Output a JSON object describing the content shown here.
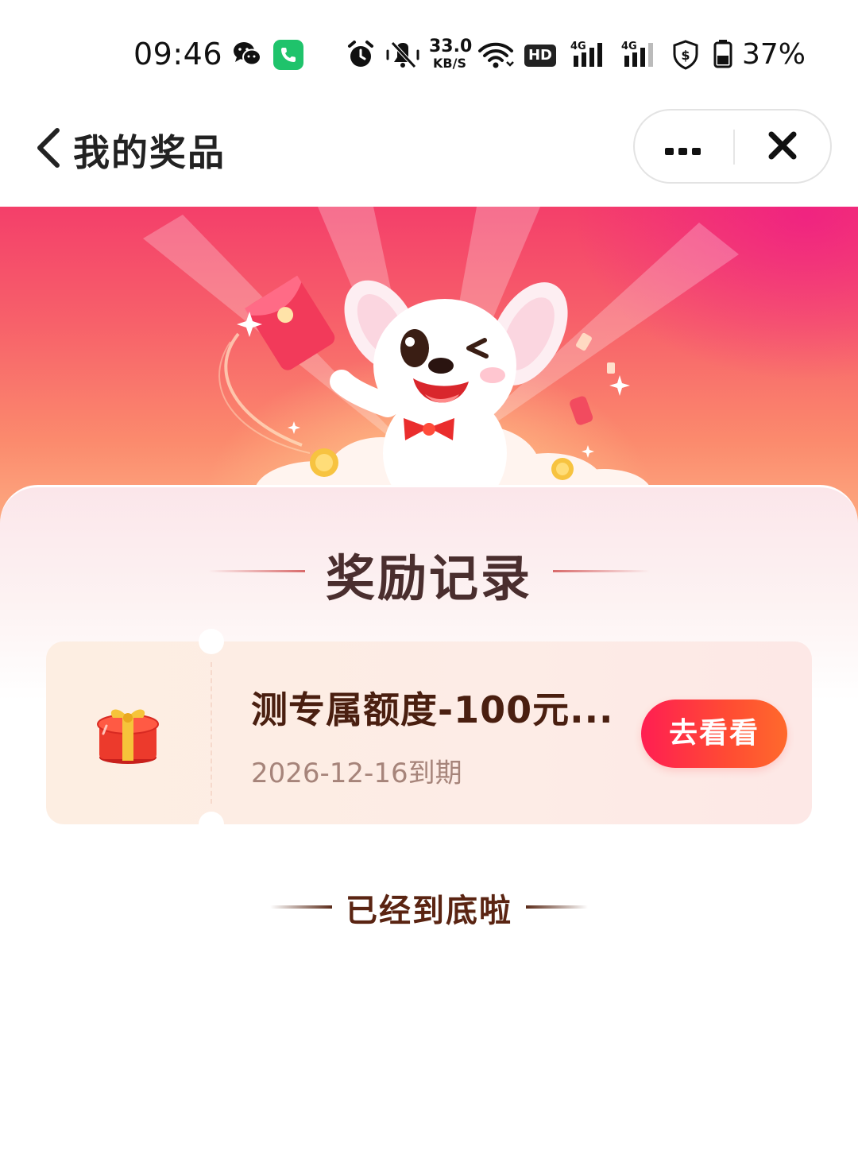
{
  "status_bar": {
    "time": "09:46",
    "network_speed_value": "33.0",
    "network_speed_unit": "KB/S",
    "hd_label": "HD",
    "signal_label_1": "4G",
    "signal_label_2": "4G",
    "battery_percent": "37%",
    "icons": [
      "wechat-icon",
      "phone-call-icon",
      "alarm-icon",
      "mute-icon",
      "wifi-icon",
      "hd-icon",
      "signal-icon",
      "signal-icon",
      "shield-icon",
      "battery-icon"
    ],
    "colors": {
      "phone_badge": "#1fc36b"
    }
  },
  "nav": {
    "title": "我的奖品",
    "back_icon": "chevron-left-icon",
    "more_icon": "more-dots-icon",
    "close_icon": "close-icon"
  },
  "section": {
    "title": "奖励记录"
  },
  "rewards": [
    {
      "name": "测专属额度-100元...",
      "expiry": "2026-12-16到期",
      "action_label": "去看看",
      "icon": "gift-box-icon"
    }
  ],
  "list_end_text": "已经到底啦",
  "colors": {
    "accent": "#ff2a4e",
    "banner_top": "#f43f6a",
    "banner_bottom": "#fdb185",
    "title_text": "#4a2e2e",
    "reward_name": "#4a1f10",
    "expiry_text": "#a6847a"
  }
}
